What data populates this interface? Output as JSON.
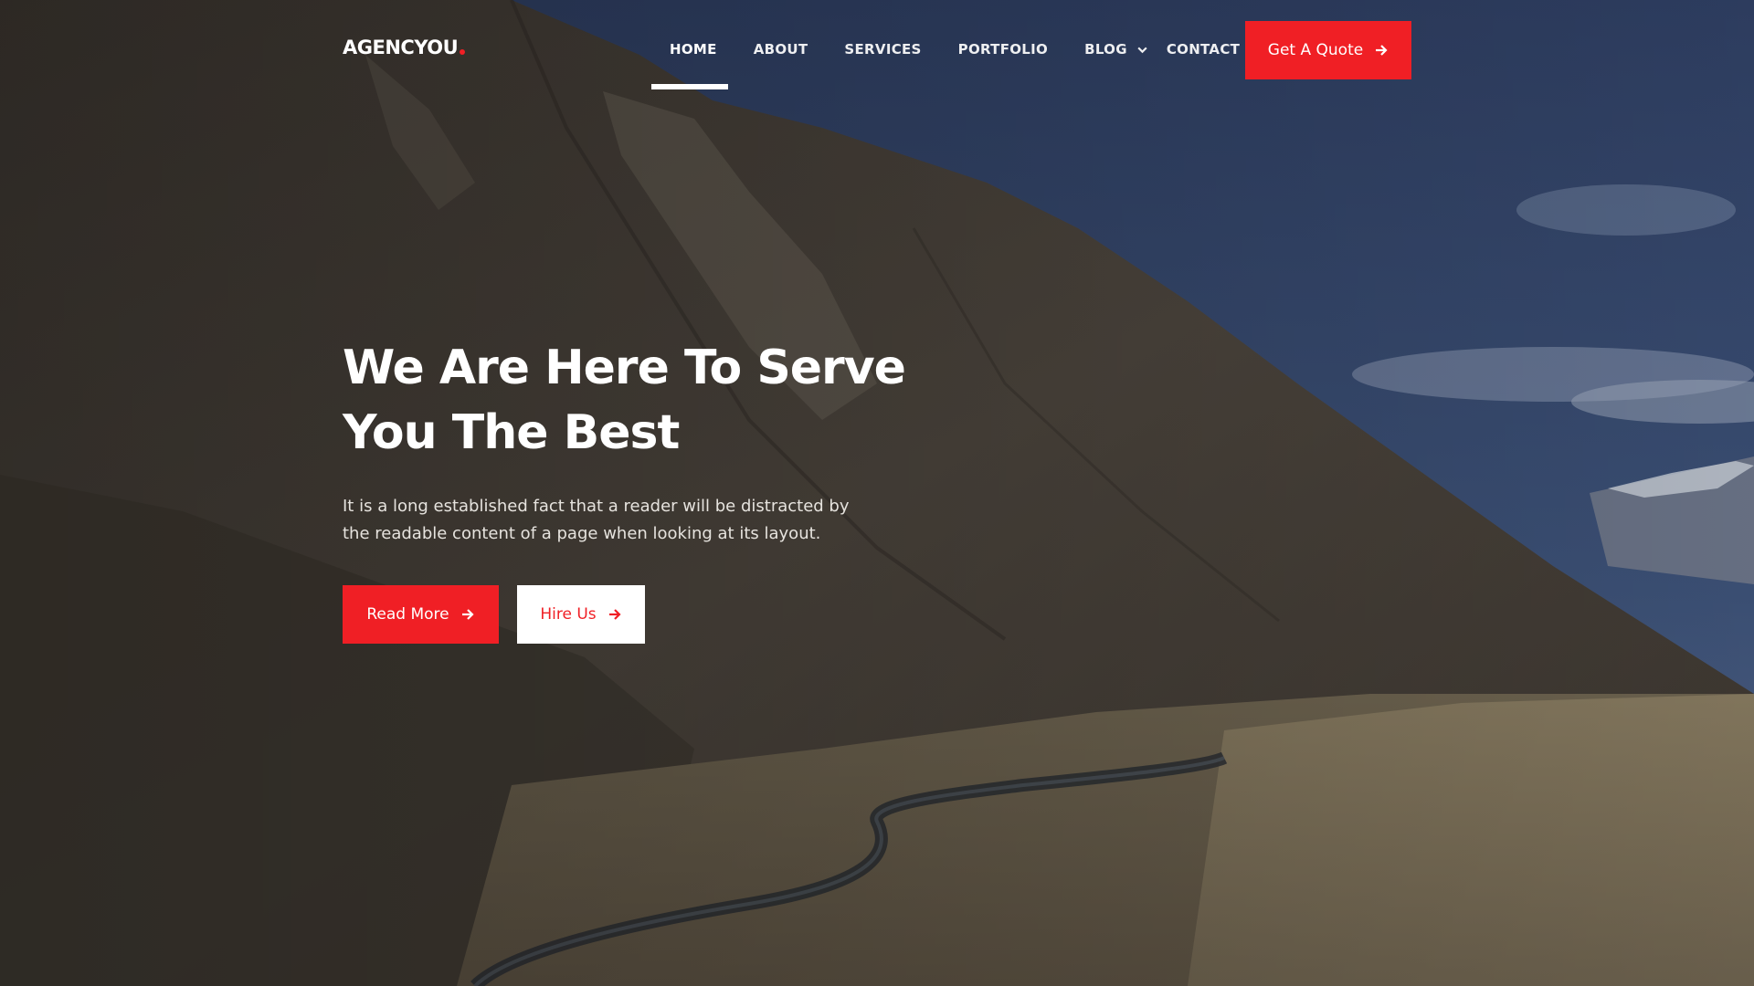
{
  "colors": {
    "accent": "#f01f25",
    "white": "#ffffff",
    "sky": "#36496e",
    "mountain": "#4a433b"
  },
  "header": {
    "logo": "AGENCYOU",
    "nav": [
      {
        "label": "HOME",
        "active": true
      },
      {
        "label": "ABOUT",
        "active": false
      },
      {
        "label": "SERVICES",
        "active": false
      },
      {
        "label": "PORTFOLIO",
        "active": false
      },
      {
        "label": "BLOG",
        "active": false,
        "has_dropdown": true
      },
      {
        "label": "CONTACT",
        "active": false
      }
    ],
    "quote_button": "Get A Quote",
    "icons": {
      "dropdown": "chevron-down-icon",
      "arrow": "arrow-right-icon"
    }
  },
  "hero": {
    "title_line1": "We Are Here To Serve",
    "title_line2": "You The Best",
    "text": "It is a long established fact that a reader will be distracted by the readable content of a page when looking at its layout.",
    "primary_button": "Read More",
    "secondary_button": "Hire Us"
  }
}
